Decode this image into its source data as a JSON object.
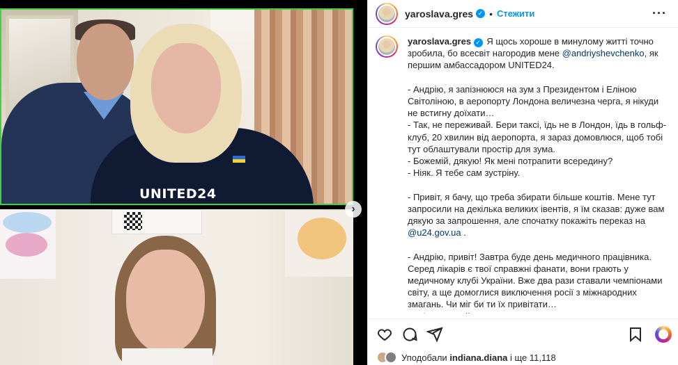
{
  "post": {
    "username": "yaroslava.gres",
    "follow_label": "Стежити",
    "separator": "•",
    "caption_lines": [
      "Я щось хороше в минулому житті точно",
      "зробила, бо всесвіт нагородив мене "
    ],
    "mention_user": "@andriyshevchenko",
    "caption_after_mention": ", як\nпершим амбассадором UNITED24.\n\n- Андрію, я запізнююся на зум з Президентом і Еліною\nСвітоліною, в аеропорту Лондона величезна черга, я нікуди\nне встигну доїхати…\n- Так, не переживай. Бери таксі, їдь не в Лондон, їдь в гольф-\nклуб, 20 хвилин від аеропорта, я зараз домовлюся, щоб тобі\nтут облаштували простір для зума.\n- Божемій, дякую! Як мені потрапити всередину?\n- Ніяк. Я тебе сам зустріну.\n\n- Привіт, я бачу, що треба збирати більше коштів. Мене тут\nзапросили на декілька великих івентів, я їм сказав: дуже вам\nдякую за запрошення, але спочатку покажіть переказ на\n",
    "link_text": "@u24.gov.ua",
    "caption_end": " .\n\n- Андрію, привіт! Завтра буде день медичного працівника.\nСеред лікарів є твої справжні фанати, вони грають у\nмедичному клубі України. Вже два рази ставали чемпіонами\nсвіту, а ще домоглися виключення росії з міжнародних\nзмагань. Чи міг би ти їх привітати…\n- Звісно, давай. А як?",
    "media_text": "UNITED24",
    "liked_by_prefix": "Уподобали ",
    "liked_by_user": "indiana.diana",
    "liked_by_suffix": " і ще 11,118"
  },
  "icons": {
    "verified": "verified-badge-icon",
    "more": "more-options-icon",
    "like": "heart-icon",
    "comment": "comment-icon",
    "share": "share-icon",
    "save": "bookmark-icon",
    "next": "chevron-right-icon"
  },
  "colors": {
    "accent": "#0095f6",
    "mention": "#00376b",
    "video_border": "#3fd13f"
  }
}
